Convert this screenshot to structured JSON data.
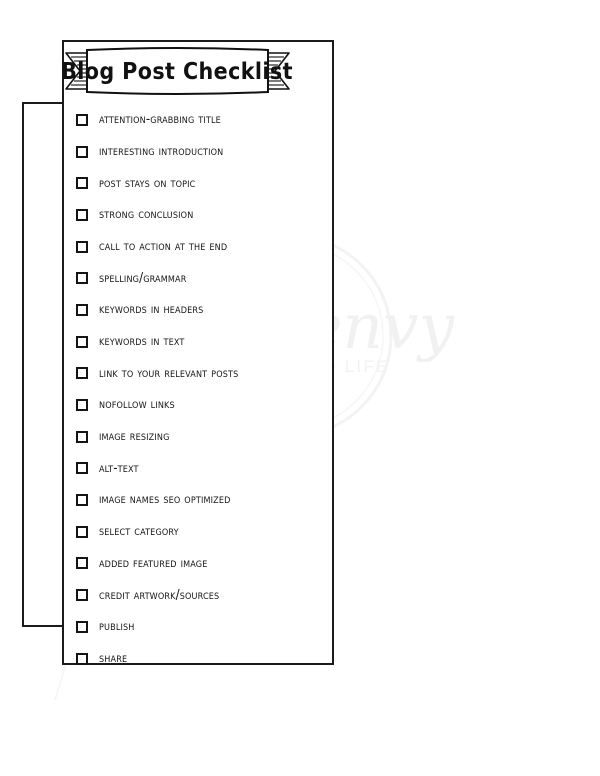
{
  "document": {
    "title": "Blog Post Checklist",
    "type": "printable-checklist"
  },
  "watermark": {
    "brand": "mom envy",
    "tagline": "KIDS • HOME • LIFE",
    "color": "#f1f1f1"
  },
  "colors": {
    "ink": "#1b1b1b",
    "paper": "#ffffff",
    "watermark": "#f1f1f1"
  },
  "checklist": {
    "count": 18,
    "items": [
      {
        "label": "Attention-Grabbing Title",
        "checked": false
      },
      {
        "label": "Interesting Introduction",
        "checked": false
      },
      {
        "label": "Post Stays on Topic",
        "checked": false
      },
      {
        "label": "Strong Conclusion",
        "checked": false
      },
      {
        "label": "Call to Action at the End",
        "checked": false
      },
      {
        "label": "Spelling/Grammar",
        "checked": false
      },
      {
        "label": "Keywords in Headers",
        "checked": false
      },
      {
        "label": "Keywords in Text",
        "checked": false
      },
      {
        "label": "Link to Your Relevant Posts",
        "checked": false
      },
      {
        "label": "NOFOLLOW LINKS",
        "checked": false
      },
      {
        "label": "Image Resizing",
        "checked": false
      },
      {
        "label": "ALT-TEXT",
        "checked": false
      },
      {
        "label": "Image Names SEO Optimized",
        "checked": false
      },
      {
        "label": "Select Category",
        "checked": false
      },
      {
        "label": "added Featured Image",
        "checked": false
      },
      {
        "label": "Credit Artwork/Sources",
        "checked": false
      },
      {
        "label": "Publish",
        "checked": false
      },
      {
        "label": "SHARE",
        "checked": false
      }
    ]
  }
}
